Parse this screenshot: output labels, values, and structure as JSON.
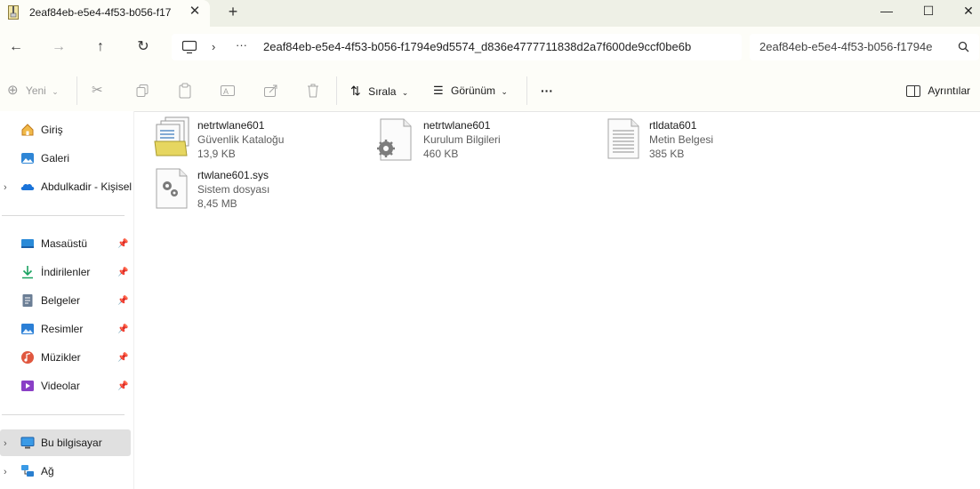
{
  "tab": {
    "title": "2eaf84eb-e5e4-4f53-b056-f17"
  },
  "address": {
    "path": "2eaf84eb-e5e4-4f53-b056-f1794e9d5574_d836e4777711838d2a7f600de9ccf0be6b",
    "overflow": "···"
  },
  "search": {
    "value": "2eaf84eb-e5e4-4f53-b056-f1794e"
  },
  "commands": {
    "new": "Yeni",
    "sort": "Sırala",
    "view": "Görünüm",
    "more": "···",
    "details": "Ayrıntılar"
  },
  "sidebar": {
    "top": [
      {
        "label": "Giriş"
      },
      {
        "label": "Galeri"
      },
      {
        "label": "Abdulkadir - Kişisel"
      }
    ],
    "pinned": [
      {
        "label": "Masaüstü"
      },
      {
        "label": "İndirilenler"
      },
      {
        "label": "Belgeler"
      },
      {
        "label": "Resimler"
      },
      {
        "label": "Müzikler"
      },
      {
        "label": "Videolar"
      }
    ],
    "bottom": [
      {
        "label": "Bu bilgisayar"
      },
      {
        "label": "Ağ"
      }
    ]
  },
  "files": [
    {
      "name": "netrtwlane601",
      "type": "Güvenlik Kataloğu",
      "size": "13,9 KB",
      "icon": "security-catalog-icon"
    },
    {
      "name": "netrtwlane601",
      "type": "Kurulum Bilgileri",
      "size": "460 KB",
      "icon": "setup-info-icon"
    },
    {
      "name": "rtldata601",
      "type": "Metin Belgesi",
      "size": "385 KB",
      "icon": "text-document-icon"
    },
    {
      "name": "rtwlane601.sys",
      "type": "Sistem dosyası",
      "size": "8,45 MB",
      "icon": "system-file-icon"
    }
  ],
  "colors": {
    "accent": "#0067c0",
    "titlebar": "#eef0e6",
    "toolbar": "#fdfdf8",
    "selected": "#e0e0e0"
  }
}
